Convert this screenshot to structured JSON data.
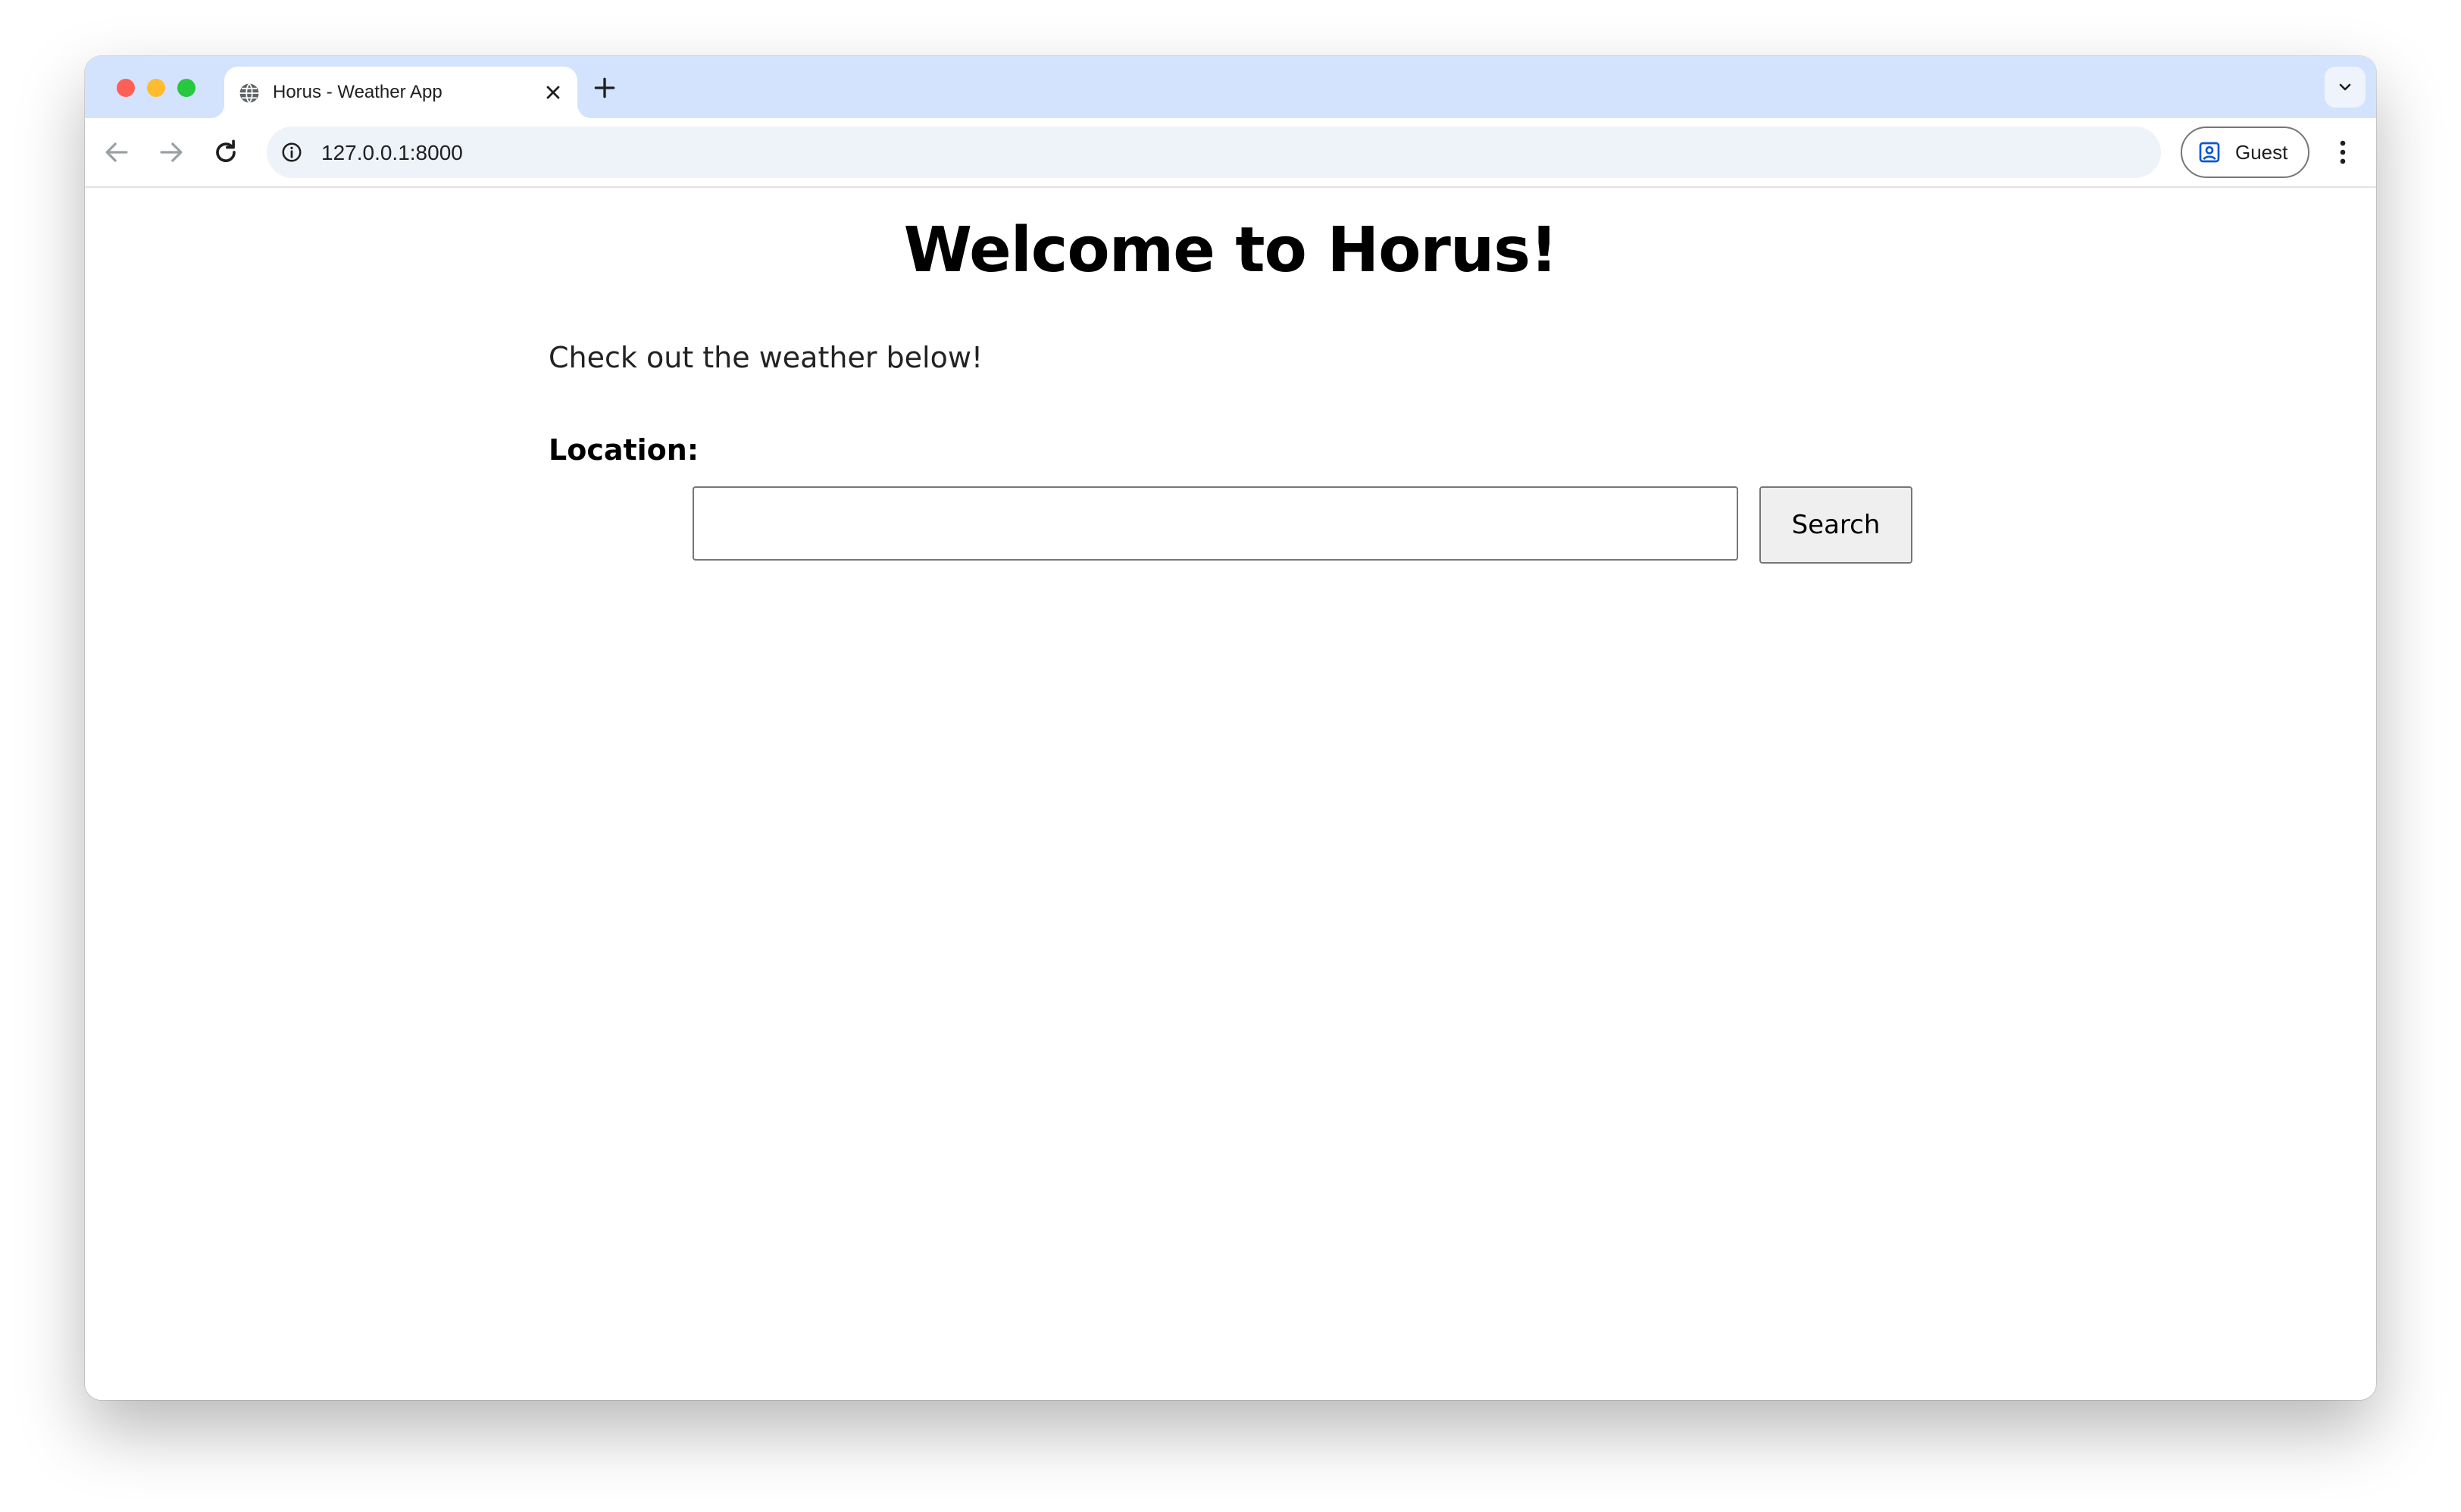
{
  "browser": {
    "tab": {
      "title": "Horus - Weather App",
      "favicon": "globe-icon"
    },
    "address_bar": {
      "url": "127.0.0.1:8000",
      "site_info_icon": "info-icon"
    },
    "profile": {
      "label": "Guest",
      "icon": "person-badge-icon"
    },
    "icons": {
      "back": "arrow-left-icon",
      "forward": "arrow-right-icon",
      "reload": "reload-icon",
      "new_tab": "plus-icon",
      "tab_close": "close-icon",
      "tab_search": "chevron-down-icon",
      "menu": "kebab-menu-icon"
    }
  },
  "page": {
    "heading": "Welcome to Horus!",
    "subtitle": "Check out the weather below!",
    "location_label": "Location:",
    "location_input": {
      "value": "",
      "placeholder": ""
    },
    "search_button_label": "Search"
  },
  "colors": {
    "tabstrip_bg": "#d3e3fd",
    "omnibox_bg": "#eef2f9",
    "button_bg": "#efefef"
  }
}
